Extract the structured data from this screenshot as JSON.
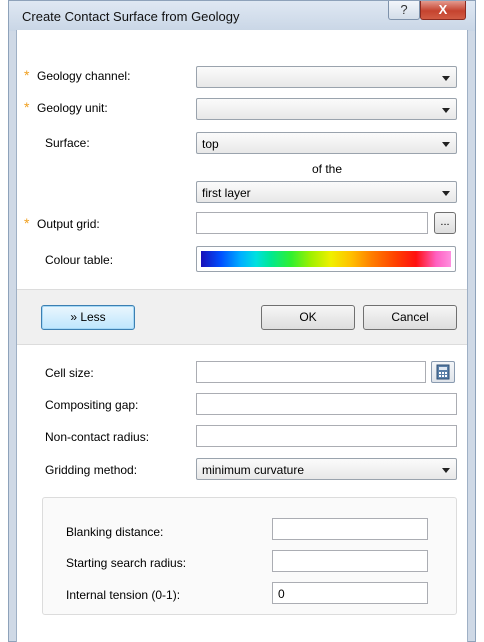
{
  "window": {
    "title": "Create Contact Surface from Geology",
    "help_label": "?",
    "close_label": "X"
  },
  "form": {
    "geology_channel": {
      "label": "Geology channel:",
      "value": ""
    },
    "geology_unit": {
      "label": "Geology unit:",
      "value": ""
    },
    "surface": {
      "label": "Surface:",
      "value": "top"
    },
    "of_the": "of the",
    "layer": {
      "value": "first layer"
    },
    "output_grid": {
      "label": "Output grid:",
      "value": "",
      "browse_label": "..."
    },
    "colour_table": {
      "label": "Colour table:"
    },
    "required_marker": "*"
  },
  "buttons": {
    "less_label": "» Less",
    "ok_label": "OK",
    "cancel_label": "Cancel"
  },
  "advanced": {
    "cell_size": {
      "label": "Cell size:",
      "value": ""
    },
    "compositing_gap": {
      "label": "Compositing gap:",
      "value": ""
    },
    "non_contact_radius": {
      "label": "Non-contact radius:",
      "value": ""
    },
    "gridding_method": {
      "label": "Gridding method:",
      "value": "minimum curvature"
    },
    "blanking_distance": {
      "label": "Blanking distance:",
      "value": ""
    },
    "starting_search_radius": {
      "label": "Starting search radius:",
      "value": ""
    },
    "internal_tension": {
      "label": "Internal tension (0-1):",
      "value": "0"
    }
  },
  "icons": {
    "browse": "ellipsis-icon",
    "cell_size_helper": "grid-calculator-icon"
  }
}
